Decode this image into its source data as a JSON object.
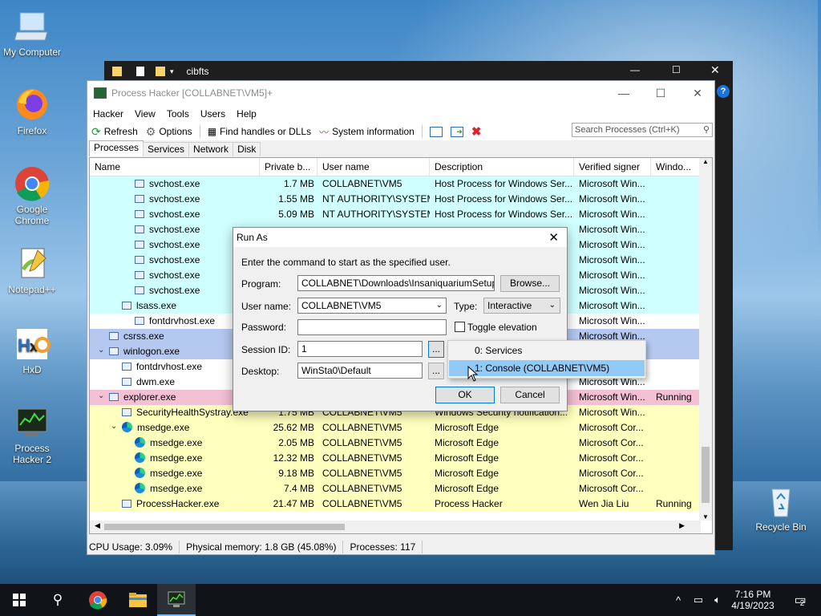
{
  "desktop": {
    "icons": [
      {
        "label": "My Computer"
      },
      {
        "label": "Firefox"
      },
      {
        "label": "Google Chrome"
      },
      {
        "label": "Notepad++"
      },
      {
        "label": "HxD"
      },
      {
        "label": "Process Hacker 2"
      },
      {
        "label": "Recycle Bin"
      }
    ]
  },
  "explorer_bg": {
    "title": "cibfts"
  },
  "window": {
    "title": "Process Hacker [COLLABNET\\VM5]+",
    "menu": [
      "Hacker",
      "View",
      "Tools",
      "Users",
      "Help"
    ],
    "toolbar": {
      "refresh": "Refresh",
      "options": "Options",
      "find_handles": "Find handles or DLLs",
      "system_info": "System information"
    },
    "search_placeholder": "Search Processes (Ctrl+K)",
    "tabs": [
      "Processes",
      "Services",
      "Network",
      "Disk"
    ],
    "columns": [
      "Name",
      "Private b...",
      "User name",
      "Description",
      "Verified signer",
      "Windo..."
    ],
    "rows": [
      {
        "name": "svchost.exe",
        "priv": "1.7 MB",
        "user": "COLLABNET\\VM5",
        "desc": "Host Process for Windows Ser...",
        "signer": "Microsoft Win...",
        "win": ""
      },
      {
        "name": "svchost.exe",
        "priv": "1.55 MB",
        "user": "NT AUTHORITY\\SYSTEM",
        "desc": "Host Process for Windows Ser...",
        "signer": "Microsoft Win...",
        "win": ""
      },
      {
        "name": "svchost.exe",
        "priv": "5.09 MB",
        "user": "NT AUTHORITY\\SYSTEM",
        "desc": "Host Process for Windows Ser...",
        "signer": "Microsoft Win...",
        "win": ""
      },
      {
        "name": "svchost.exe",
        "priv": "",
        "user": "",
        "desc": "",
        "signer": "Microsoft Win...",
        "win": ""
      },
      {
        "name": "svchost.exe",
        "priv": "",
        "user": "",
        "desc": "",
        "signer": "Microsoft Win...",
        "win": ""
      },
      {
        "name": "svchost.exe",
        "priv": "",
        "user": "",
        "desc": "",
        "signer": "Microsoft Win...",
        "win": ""
      },
      {
        "name": "svchost.exe",
        "priv": "",
        "user": "",
        "desc": "",
        "signer": "Microsoft Win...",
        "win": ""
      },
      {
        "name": "svchost.exe",
        "priv": "",
        "user": "",
        "desc": "",
        "signer": "Microsoft Win...",
        "win": ""
      },
      {
        "name": "lsass.exe",
        "priv": "",
        "user": "",
        "desc": "",
        "signer": "Microsoft Win...",
        "win": ""
      },
      {
        "name": "fontdrvhost.exe",
        "priv": "",
        "user": "",
        "desc": "",
        "signer": "Microsoft Win...",
        "win": ""
      },
      {
        "name": "csrss.exe",
        "priv": "",
        "user": "",
        "desc": "",
        "signer": "Microsoft Win...",
        "win": ""
      },
      {
        "name": "winlogon.exe",
        "priv": "",
        "user": "",
        "desc": "",
        "signer": "",
        "win": ""
      },
      {
        "name": "fontdrvhost.exe",
        "priv": "",
        "user": "",
        "desc": "",
        "signer": "",
        "win": ""
      },
      {
        "name": "dwm.exe",
        "priv": "",
        "user": "",
        "desc": "",
        "signer": "Microsoft Win...",
        "win": ""
      },
      {
        "name": "explorer.exe",
        "priv": "",
        "user": "",
        "desc": "",
        "signer": "Microsoft Win...",
        "win": "Running"
      },
      {
        "name": "SecurityHealthSystray.exe",
        "priv": "1.75 MB",
        "user": "COLLABNET\\VM5",
        "desc": "Windows Security notification...",
        "signer": "Microsoft Win...",
        "win": ""
      },
      {
        "name": "msedge.exe",
        "priv": "25.62 MB",
        "user": "COLLABNET\\VM5",
        "desc": "Microsoft Edge",
        "signer": "Microsoft Cor...",
        "win": ""
      },
      {
        "name": "msedge.exe",
        "priv": "2.05 MB",
        "user": "COLLABNET\\VM5",
        "desc": "Microsoft Edge",
        "signer": "Microsoft Cor...",
        "win": ""
      },
      {
        "name": "msedge.exe",
        "priv": "12.32 MB",
        "user": "COLLABNET\\VM5",
        "desc": "Microsoft Edge",
        "signer": "Microsoft Cor...",
        "win": ""
      },
      {
        "name": "msedge.exe",
        "priv": "9.18 MB",
        "user": "COLLABNET\\VM5",
        "desc": "Microsoft Edge",
        "signer": "Microsoft Cor...",
        "win": ""
      },
      {
        "name": "msedge.exe",
        "priv": "7.4 MB",
        "user": "COLLABNET\\VM5",
        "desc": "Microsoft Edge",
        "signer": "Microsoft Cor...",
        "win": ""
      },
      {
        "name": "ProcessHacker.exe",
        "priv": "21.47 MB",
        "user": "COLLABNET\\VM5",
        "desc": "Process Hacker",
        "signer": "Wen Jia Liu",
        "win": "Running"
      }
    ],
    "status": {
      "cpu": "CPU Usage: 3.09%",
      "memory": "Physical memory: 1.8 GB (45.08%)",
      "processes": "Processes: 117"
    }
  },
  "dialog": {
    "title": "Run As",
    "instruction": "Enter the command to start as the specified user.",
    "program_label": "Program:",
    "program_value": "COLLABNET\\Downloads\\InsaniquariumSetup.exe",
    "browse": "Browse...",
    "username_label": "User name:",
    "username_value": "COLLABNET\\VM5",
    "type_label": "Type:",
    "type_value": "Interactive",
    "password_label": "Password:",
    "toggle_elevation": "Toggle elevation",
    "session_label": "Session ID:",
    "session_value": "1",
    "desktop_label": "Desktop:",
    "desktop_value": "WinSta0\\Default",
    "ellipsis": "...",
    "ok": "OK",
    "cancel": "Cancel",
    "session_options": [
      "0: Services",
      "1: Console (COLLABNET\\VM5)"
    ]
  },
  "taskbar": {
    "time": "7:16 PM",
    "date": "4/19/2023",
    "notifications": "2"
  }
}
